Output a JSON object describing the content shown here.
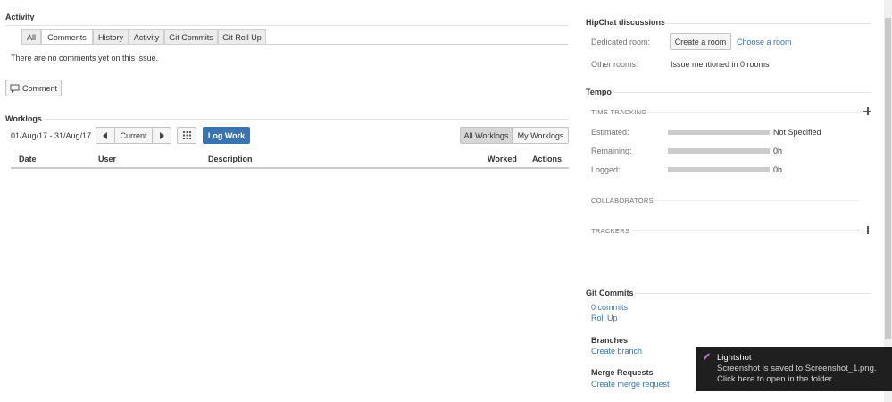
{
  "activity": {
    "title": "Activity",
    "tabs": [
      {
        "label": "All",
        "active": false
      },
      {
        "label": "Comments",
        "active": true
      },
      {
        "label": "History",
        "active": false
      },
      {
        "label": "Activity",
        "active": false
      },
      {
        "label": "Git Commits",
        "active": false
      },
      {
        "label": "Git Roll Up",
        "active": false
      }
    ],
    "empty_message": "There are no comments yet on this issue.",
    "comment_button": "Comment"
  },
  "worklogs": {
    "title": "Worklogs",
    "date_range": "01/Aug/17 - 31/Aug/17",
    "current_label": "Current",
    "log_work_label": "Log Work",
    "all_worklogs_label": "All Worklogs",
    "my_worklogs_label": "My Worklogs",
    "columns": [
      "Date",
      "User",
      "Description",
      "Worked",
      "Actions"
    ]
  },
  "hipchat": {
    "title": "HipChat discussions",
    "dedicated_room_label": "Dedicated room:",
    "create_room_label": "Create a room",
    "choose_room_label": "Choose a room",
    "other_rooms_label": "Other rooms:",
    "other_rooms_value": "Issue mentioned in 0 rooms"
  },
  "tempo": {
    "title": "Tempo",
    "time_tracking_label": "TIME TRACKING",
    "rows": [
      {
        "label": "Estimated:",
        "value": "Not Specified"
      },
      {
        "label": "Remaining:",
        "value": "0h"
      },
      {
        "label": "Logged:",
        "value": "0h"
      }
    ],
    "collaborators_label": "COLLABORATORS",
    "trackers_label": "TRACKERS"
  },
  "git": {
    "title": "Git Commits",
    "commits_link": "0 commits",
    "rollup_link": "Roll Up",
    "branches_title": "Branches",
    "create_branch_link": "Create branch",
    "merge_title": "Merge Requests",
    "create_merge_link": "Create merge request"
  },
  "toast": {
    "title": "Lightshot",
    "line1": "Screenshot is saved to Screenshot_1.png.",
    "line2": "Click here to open in the folder."
  },
  "colors": {
    "primary": "#3b73af",
    "toast_bg": "#1f1f1f",
    "feather": "#c678dd"
  }
}
